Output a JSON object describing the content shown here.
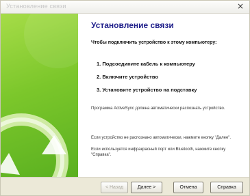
{
  "window": {
    "title": "Установление связи",
    "close_glyph": "×"
  },
  "content": {
    "heading": "Установление связи",
    "intro": "Чтобы подключить устройство к этому компьютеру:",
    "steps": [
      "1. Подсоедините кабель к компьютеру",
      "2. Включите устройство",
      "3. Установите устройство на подставку"
    ],
    "note_activesync": "Программа ActiveSync должна автоматически распознать устройство.",
    "note_help_1": "Если устройство не распознано автоматически, нажмите кнопку \"Далее\".",
    "note_help_2": "Если используется инфракрасный порт или Bluetooth, нажмите кнопку \"Справка\"."
  },
  "footer": {
    "back_label": "< Назад",
    "next_label": "Далее >",
    "cancel_label": "Отмена",
    "help_label": "Справка"
  },
  "icons": {
    "banner": "sync-arrows-icon",
    "close": "close-icon"
  },
  "colors": {
    "banner_green": "#7cc72b",
    "heading_blue": "#1f1f8a"
  }
}
